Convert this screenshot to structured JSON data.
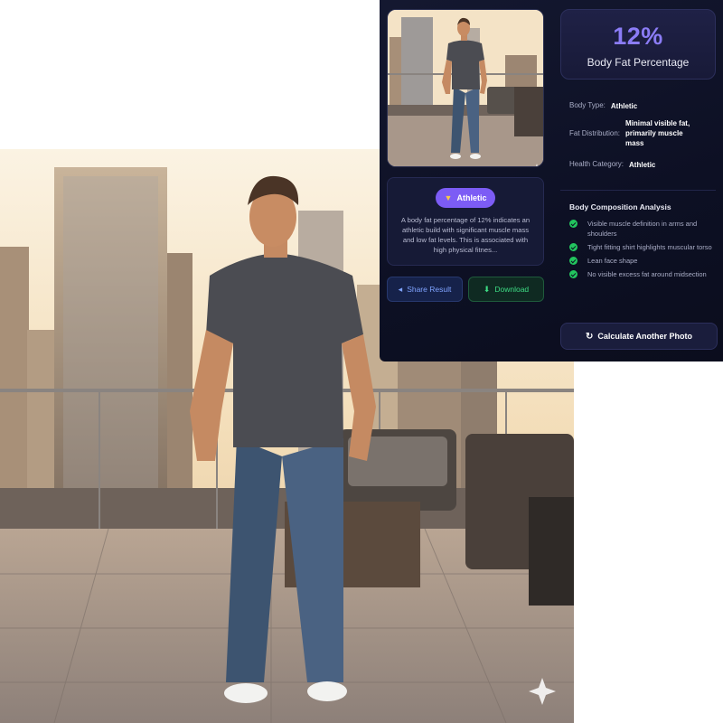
{
  "result": {
    "percentage": "12%",
    "label": "Body Fat Percentage"
  },
  "details": {
    "body_type_key": "Body Type:",
    "body_type_value": "Athletic",
    "fat_distribution_key": "Fat Distribution:",
    "fat_distribution_value": "Minimal visible fat, primarily muscle mass",
    "health_category_key": "Health Category:",
    "health_category_value": "Athletic"
  },
  "analysis": {
    "title": "Body Composition Analysis",
    "items": [
      "Visible muscle definition in arms and shoulders",
      "Tight fitting shirt highlights muscular torso",
      "Lean face shape",
      "No visible excess fat around midsection"
    ]
  },
  "category_card": {
    "badge": "Athletic",
    "badge_icon": "medal-icon",
    "description": "A body fat percentage of 12% indicates an athletic build with significant muscle mass and low fat levels. This is associated with high physical fitnes..."
  },
  "actions": {
    "share": "Share Result",
    "download": "Download",
    "calculate_again": "Calculate Another Photo"
  },
  "colors": {
    "accent": "#8b7cf6",
    "badge": "#7c5cf5",
    "success": "#22c55e",
    "panel_bg": "#0d1024"
  }
}
